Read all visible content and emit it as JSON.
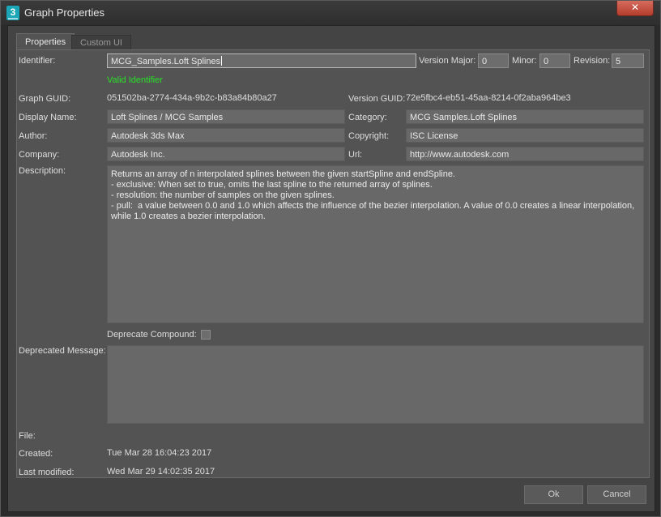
{
  "window": {
    "title": "Graph Properties",
    "icon_glyph": "3",
    "close_glyph": "✕"
  },
  "tabs": [
    {
      "label": "Properties",
      "active": true
    },
    {
      "label": "Custom UI",
      "active": false
    }
  ],
  "form": {
    "identifier": {
      "label": "Identifier:",
      "value": "MCG_Samples.Loft Splines"
    },
    "version_major": {
      "label": "Version Major:",
      "value": "0"
    },
    "minor": {
      "label": "Minor:",
      "value": "0"
    },
    "revision": {
      "label": "Revision:",
      "value": "5"
    },
    "valid_text": "Valid Identifier",
    "graph_guid": {
      "label": "Graph GUID:",
      "value": "051502ba-2774-434a-9b2c-b83a84b80a27"
    },
    "version_guid": {
      "label": "Version GUID:",
      "value": "72e5fbc4-eb51-45aa-8214-0f2aba964be3"
    },
    "display_name": {
      "label": "Display Name:",
      "value": "Loft Splines / MCG Samples"
    },
    "category": {
      "label": "Category:",
      "value": "MCG Samples.Loft Splines"
    },
    "author": {
      "label": "Author:",
      "value": "Autodesk 3ds Max"
    },
    "copyright": {
      "label": "Copyright:",
      "value": "ISC License"
    },
    "company": {
      "label": "Company:",
      "value": "Autodesk Inc."
    },
    "url": {
      "label": "Url:",
      "value": "http://www.autodesk.com"
    },
    "description": {
      "label": "Description:",
      "value": "Returns an array of n interpolated splines between the given startSpline and endSpline.\n- exclusive: When set to true, omits the last spline to the returned array of splines.\n- resolution: the number of samples on the given splines.\n- pull:  a value between 0.0 and 1.0 which affects the influence of the bezier interpolation. A value of 0.0 creates a linear interpolation, while 1.0 creates a bezier interpolation."
    },
    "deprecate_compound": {
      "label": "Deprecate Compound:",
      "checked": false
    },
    "deprecated_message": {
      "label": "Deprecated Message:",
      "value": ""
    },
    "file": {
      "label": "File:",
      "value": ""
    },
    "created": {
      "label": "Created:",
      "value": "Tue Mar 28 16:04:23 2017"
    },
    "last_modified": {
      "label": "Last modified:",
      "value": "Wed Mar 29 14:02:35 2017"
    }
  },
  "buttons": {
    "ok": "Ok",
    "cancel": "Cancel"
  },
  "colors": {
    "valid_green": "#28e028",
    "close_red": "#c74a38"
  }
}
